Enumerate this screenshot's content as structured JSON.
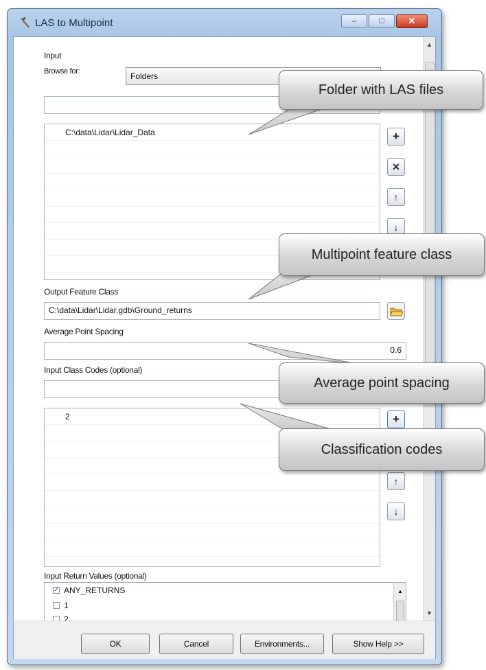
{
  "window": {
    "title": "LAS to Multipoint",
    "icon": "hammer-tool-icon",
    "controls": {
      "minimize": "–",
      "maximize": "□",
      "close": "✕"
    }
  },
  "input_section": {
    "heading": "Input",
    "browse_label": "Browse for:",
    "browse_value": "Folders",
    "path_value": "",
    "list_items": [
      "C:\\data\\Lidar\\Lidar_Data"
    ]
  },
  "side_buttons": {
    "add": "+",
    "remove": "✕",
    "move_up": "↑",
    "move_down": "↓"
  },
  "output": {
    "label": "Output Feature Class",
    "value": "C:\\data\\Lidar\\Lidar.gdb\\Ground_returns"
  },
  "spacing": {
    "label": "Average Point Spacing",
    "value": "0.6"
  },
  "class_codes": {
    "label": "Input Class Codes (optional)",
    "input_value": "",
    "list_items": [
      "2"
    ]
  },
  "return_values": {
    "label": "Input Return Values (optional)",
    "items": [
      {
        "label": "ANY_RETURNS",
        "checked": true
      },
      {
        "label": "1",
        "checked": false
      },
      {
        "label": "2",
        "checked": false
      }
    ]
  },
  "buttons": {
    "ok": "OK",
    "cancel": "Cancel",
    "environments": "Environments...",
    "show_help": "Show Help >>"
  },
  "callouts": {
    "folder": "Folder with LAS files",
    "multipoint": "Multipoint feature class",
    "spacing": "Average point spacing",
    "codes": "Classification codes"
  },
  "colors": {
    "title_bar": "#b9d3ee",
    "close_button": "#c43b20",
    "callout_fill": "#d7d7d7"
  }
}
